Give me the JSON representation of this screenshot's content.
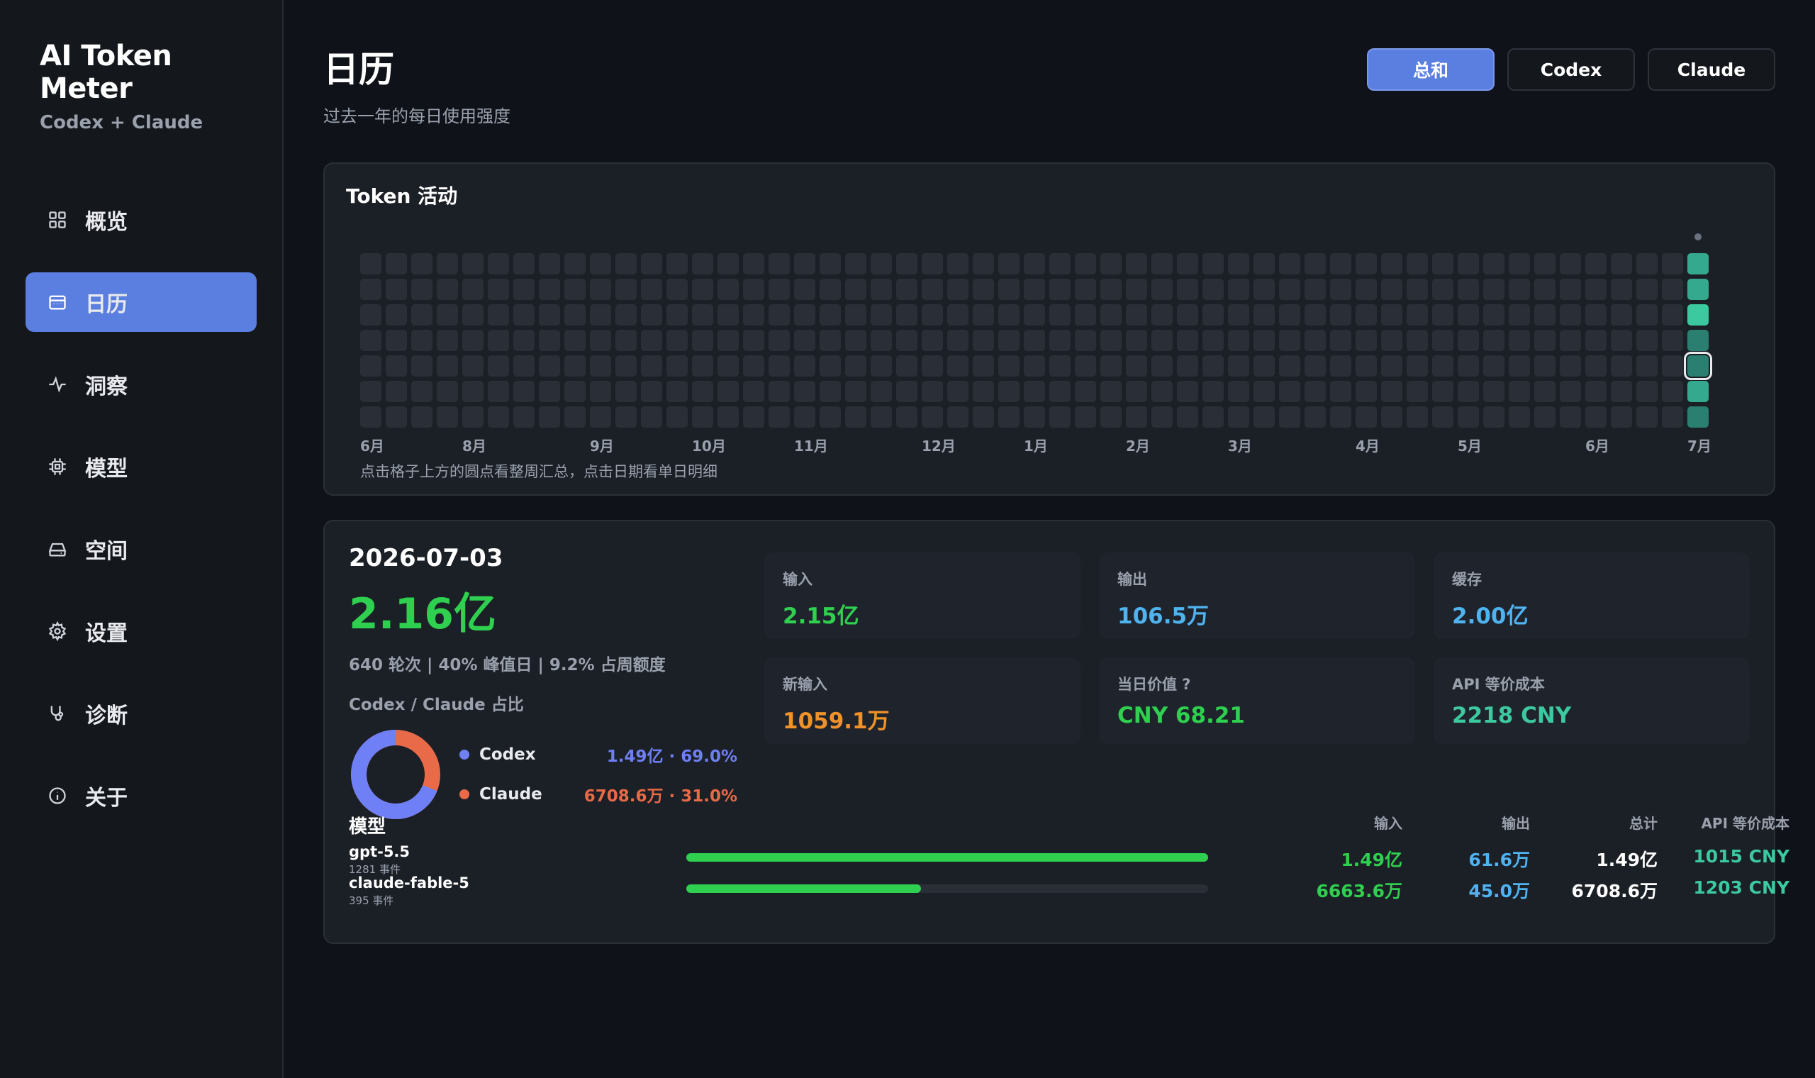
{
  "app": {
    "title": "AI Token Meter",
    "subtitle": "Codex + Claude"
  },
  "sidebar": {
    "items": [
      {
        "label": "概览",
        "icon": "grid-icon"
      },
      {
        "label": "日历",
        "icon": "calendar-icon",
        "active": true
      },
      {
        "label": "洞察",
        "icon": "pulse-icon"
      },
      {
        "label": "模型",
        "icon": "chip-icon"
      },
      {
        "label": "空间",
        "icon": "drive-icon"
      },
      {
        "label": "设置",
        "icon": "gear-icon"
      },
      {
        "label": "诊断",
        "icon": "stethoscope-icon"
      },
      {
        "label": "关于",
        "icon": "info-icon"
      }
    ]
  },
  "header": {
    "title": "日历",
    "subtitle": "过去一年的每日使用强度"
  },
  "segments": [
    {
      "label": "总和",
      "active": true
    },
    {
      "label": "Codex"
    },
    {
      "label": "Claude"
    }
  ],
  "activity": {
    "title": "Token 活动",
    "months": [
      "6月",
      "8月",
      "9月",
      "10月",
      "11月",
      "12月",
      "1月",
      "2月",
      "3月",
      "4月",
      "5月",
      "6月",
      "7月"
    ],
    "hint": "点击格子上方的圆点看整周汇总，点击日期看单日明细",
    "weeks": 53,
    "last_week_levels": [
      3,
      3,
      4,
      2,
      2,
      3,
      2
    ],
    "selected_day": 4,
    "colors": {
      "empty": "#2a2f37",
      "l2": "#2a7f71",
      "l3": "#35a98d",
      "l4": "#3cc9a0"
    }
  },
  "detail": {
    "date": "2026-07-03",
    "total": "2.16亿",
    "meta": "640 轮次  |  40% 峰值日  |  9.2% 占周额度",
    "ratio_label": "Codex / Claude 占比",
    "donut": [
      {
        "name": "Codex",
        "value": "1.49亿 · 69.0%",
        "fraction": 0.69,
        "color": "#6f7ff5"
      },
      {
        "name": "Claude",
        "value": "6708.6万 · 31.0%",
        "fraction": 0.31,
        "color": "#e86a48"
      }
    ],
    "stats": [
      {
        "label": "输入",
        "value": "2.15亿",
        "color": "#2fcf4f"
      },
      {
        "label": "输出",
        "value": "106.5万",
        "color": "#4fb3f0"
      },
      {
        "label": "缓存",
        "value": "2.00亿",
        "color": "#4fb3f0"
      },
      {
        "label": "新输入",
        "value": "1059.1万",
        "color": "#f0922a"
      },
      {
        "label": "当日价值 ?",
        "value": "CNY 68.21",
        "color": "#2fcf4f"
      },
      {
        "label": "API 等价成本",
        "value": "2218 CNY",
        "color": "#3cc9a0"
      }
    ],
    "models": {
      "title": "模型",
      "columns": [
        "输入",
        "输出",
        "总计",
        "API 等价成本"
      ],
      "rows": [
        {
          "name": "gpt-5.5",
          "events": "1281 事件",
          "share": 1.0,
          "input": "1.49亿",
          "output": "61.6万",
          "total": "1.49亿",
          "cost": "1015 CNY"
        },
        {
          "name": "claude-fable-5",
          "events": "395 事件",
          "share": 0.45,
          "input": "6663.6万",
          "output": "45.0万",
          "total": "6708.6万",
          "cost": "1203 CNY"
        }
      ]
    }
  }
}
